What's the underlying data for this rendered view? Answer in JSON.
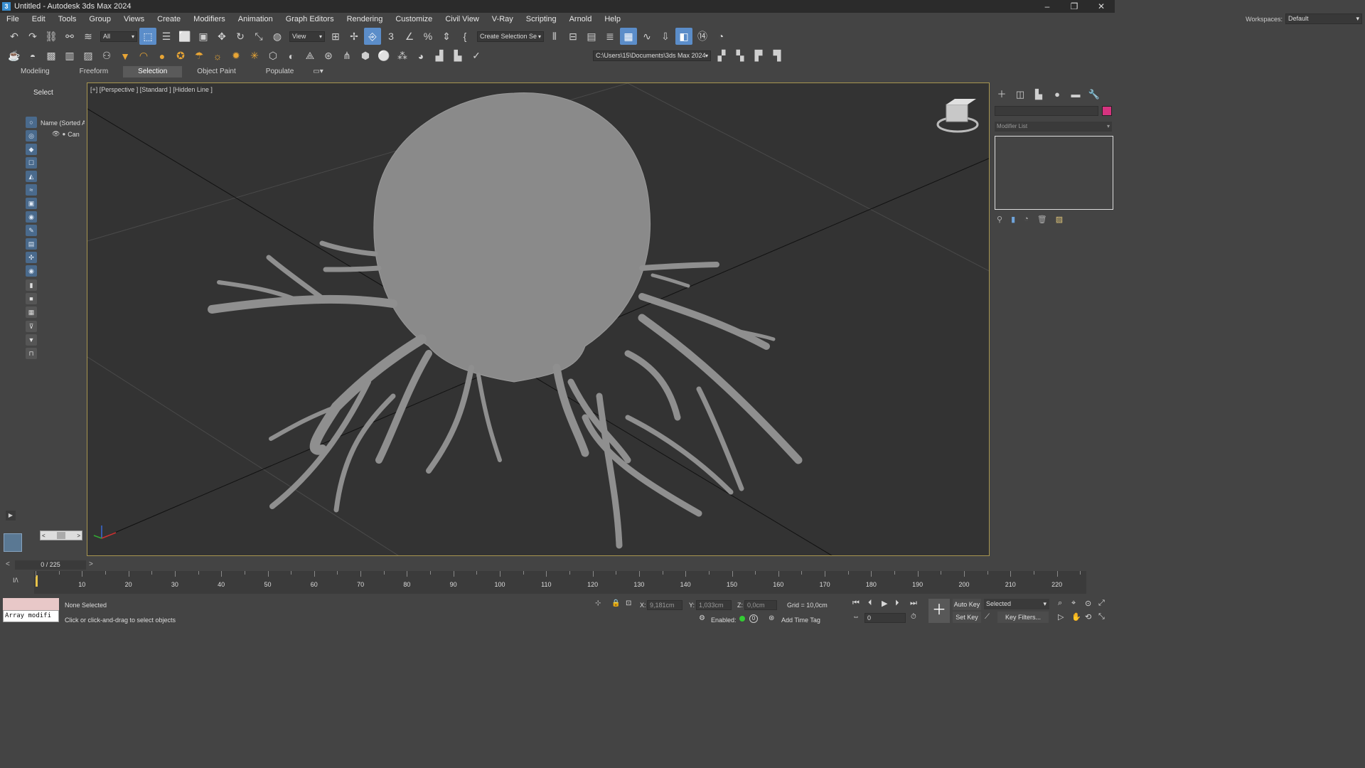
{
  "window": {
    "title": "Untitled - Autodesk 3ds Max 2024",
    "logo": "3",
    "controls": [
      "–",
      "❐",
      "✕"
    ]
  },
  "menu": {
    "items": [
      "File",
      "Edit",
      "Tools",
      "Group",
      "Views",
      "Create",
      "Modifiers",
      "Animation",
      "Graph Editors",
      "Rendering",
      "Customize",
      "Civil View",
      "V-Ray",
      "Scripting",
      "Arnold",
      "Help"
    ],
    "workspaces_label": "Workspaces:",
    "workspaces_value": "Default"
  },
  "toolbar": {
    "filter_value": "All",
    "refcoord_value": "View",
    "selection_set_value": "Create Selection Se",
    "path_value": "C:\\Users\\15\\Documents\\3ds Max 2024"
  },
  "ribbon": {
    "tabs": [
      "Modeling",
      "Freeform",
      "Selection",
      "Object Paint",
      "Populate"
    ],
    "active": "Selection"
  },
  "scene_explorer": {
    "select_label": "Select",
    "column_header": "Name (Sorted A",
    "rows": [
      "Can"
    ]
  },
  "viewport": {
    "label": "[+] [Perspective ] [Standard ] [Hidden Line ]"
  },
  "command_panel": {
    "modifier_list": "Modifier List",
    "color_swatch": "#d6337f"
  },
  "time": {
    "frame_display": "0 / 225",
    "ticks": [
      "10",
      "20",
      "30",
      "40",
      "50",
      "60",
      "70",
      "80",
      "90",
      "100",
      "110",
      "120",
      "130",
      "140",
      "150",
      "160",
      "170",
      "180",
      "190",
      "200",
      "210",
      "220"
    ]
  },
  "status": {
    "maxscript_text": "Array modifi",
    "selection": "None Selected",
    "prompt": "Click or click-and-drag to select objects",
    "x_label": "X:",
    "x_value": "9,181cm",
    "y_label": "Y:",
    "y_value": "1,033cm",
    "z_label": "Z:",
    "z_value": "0,0cm",
    "grid": "Grid = 10,0cm",
    "enabled_label": "Enabled:",
    "add_time_tag": "Add Time Tag",
    "auto_key": "Auto Key",
    "set_key": "Set Key",
    "key_mode": "Selected",
    "key_filters": "Key Filters...",
    "frame_value": "0"
  },
  "colors": {
    "accent": "#5b8dc9",
    "viewport_border": "#a89650",
    "timeline_accent": "#e8c34a"
  }
}
